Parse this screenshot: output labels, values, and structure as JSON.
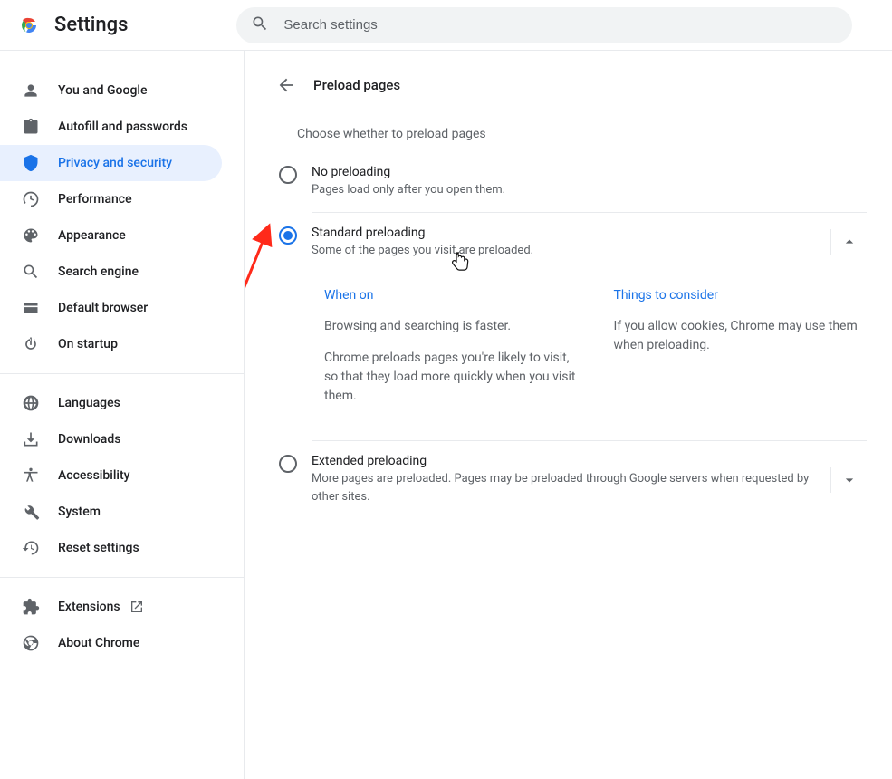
{
  "header": {
    "title": "Settings",
    "search_placeholder": "Search settings"
  },
  "sidebar": {
    "groups": [
      {
        "items": [
          {
            "icon": "person",
            "label": "You and Google"
          },
          {
            "icon": "clipboard",
            "label": "Autofill and passwords"
          },
          {
            "icon": "shield",
            "label": "Privacy and security",
            "active": true
          },
          {
            "icon": "tachometer",
            "label": "Performance"
          },
          {
            "icon": "palette",
            "label": "Appearance"
          },
          {
            "icon": "magnify",
            "label": "Search engine"
          },
          {
            "icon": "window",
            "label": "Default browser"
          },
          {
            "icon": "power",
            "label": "On startup"
          }
        ]
      },
      {
        "items": [
          {
            "icon": "globe",
            "label": "Languages"
          },
          {
            "icon": "download",
            "label": "Downloads"
          },
          {
            "icon": "accessibility",
            "label": "Accessibility"
          },
          {
            "icon": "wrench",
            "label": "System"
          },
          {
            "icon": "restore",
            "label": "Reset settings"
          }
        ]
      },
      {
        "items": [
          {
            "icon": "puzzle",
            "label": "Extensions",
            "external": true
          },
          {
            "icon": "chrome-outline",
            "label": "About Chrome"
          }
        ]
      }
    ]
  },
  "page": {
    "title": "Preload pages",
    "intro": "Choose whether to preload pages",
    "options": [
      {
        "id": "no-preloading",
        "title": "No preloading",
        "desc": "Pages load only after you open them.",
        "selected": false,
        "expandable": false
      },
      {
        "id": "standard-preloading",
        "title": "Standard preloading",
        "desc": "Some of the pages you visit are preloaded.",
        "selected": true,
        "expandable": true,
        "expanded": true,
        "details": {
          "col1_heading": "When on",
          "col1_text1": "Browsing and searching is faster.",
          "col1_text2": "Chrome preloads pages you're likely to visit, so that they load more quickly when you visit them.",
          "col2_heading": "Things to consider",
          "col2_text1": "If you allow cookies, Chrome may use them when preloading."
        }
      },
      {
        "id": "extended-preloading",
        "title": "Extended preloading",
        "desc": "More pages are preloaded. Pages may be preloaded through Google servers when requested by other sites.",
        "selected": false,
        "expandable": true,
        "expanded": false
      }
    ]
  }
}
